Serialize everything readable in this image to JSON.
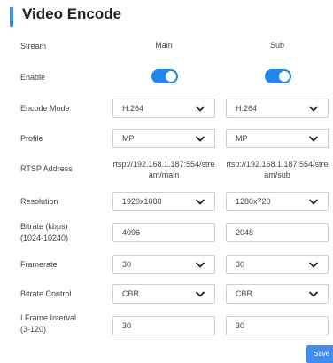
{
  "page_title": "Video Encode",
  "columns": {
    "main": "Main",
    "sub": "Sub"
  },
  "rows": {
    "stream": "Stream",
    "enable": "Enable",
    "encode_mode": "Encode Mode",
    "profile": "Profile",
    "rtsp": "RTSP Address",
    "resolution": "Resolution",
    "bitrate": "Bitrate (kbps)",
    "bitrate_range": "(1024-10240)",
    "framerate": "Framerate",
    "bitrate_control": "Bitrate Control",
    "iframe": "I Frame Interval",
    "iframe_range": "(3-120)"
  },
  "main": {
    "enabled": true,
    "encode_mode": "H.264",
    "profile": "MP",
    "rtsp_line1": "rtsp://192.168.1.187:554/stre",
    "rtsp_line2": "am/main",
    "resolution": "1920x1080",
    "bitrate": "4096",
    "framerate": "30",
    "bitrate_control": "CBR",
    "iframe": "30"
  },
  "sub": {
    "enabled": true,
    "encode_mode": "H.264",
    "profile": "MP",
    "rtsp_line1": "rtsp://192.168.1.187:554/stre",
    "rtsp_line2": "am/sub",
    "resolution": "1280x720",
    "bitrate": "2048",
    "framerate": "30",
    "bitrate_control": "CBR",
    "iframe": "30"
  },
  "save_label": "Save",
  "colors": {
    "accent": "#3d8ef0",
    "toggle_on": "#1e88f0"
  },
  "icons": {
    "select_arrow": "chevron-down-icon"
  }
}
